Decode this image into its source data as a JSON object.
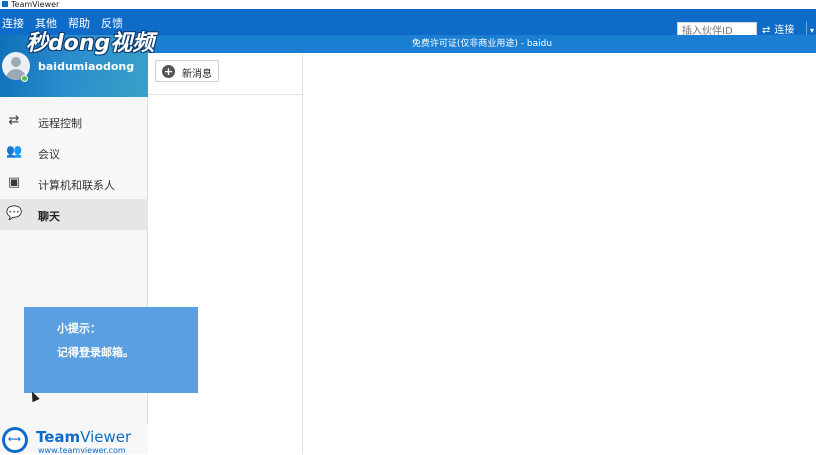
{
  "window": {
    "title": "TeamViewer"
  },
  "menu": {
    "items": [
      "连接",
      "其他",
      "帮助",
      "反馈"
    ]
  },
  "header": {
    "partner_placeholder": "插入伙伴ID",
    "connect_label": "连接",
    "accent": "#0e6cc8"
  },
  "license": {
    "text": "免费许可证(仅非商业用途) - baidu"
  },
  "profile": {
    "username": "baidumiaodong",
    "status_color": "#55c63b"
  },
  "watermark": {
    "text": "秒dong视频"
  },
  "sidebar": {
    "items": [
      {
        "label": "远程控制",
        "icon": "arrows-icon",
        "active": false
      },
      {
        "label": "会议",
        "icon": "meeting-icon",
        "active": false
      },
      {
        "label": "计算机和联系人",
        "icon": "contacts-icon",
        "active": false
      },
      {
        "label": "聊天",
        "icon": "chat-icon",
        "active": true
      }
    ]
  },
  "chat": {
    "new_message_label": "新消息"
  },
  "tip": {
    "line1": "小提示：",
    "line2": "记得登录邮箱。"
  },
  "brand": {
    "name_bold": "Team",
    "name_light": "Viewer",
    "url": "www.teamviewer.com"
  }
}
